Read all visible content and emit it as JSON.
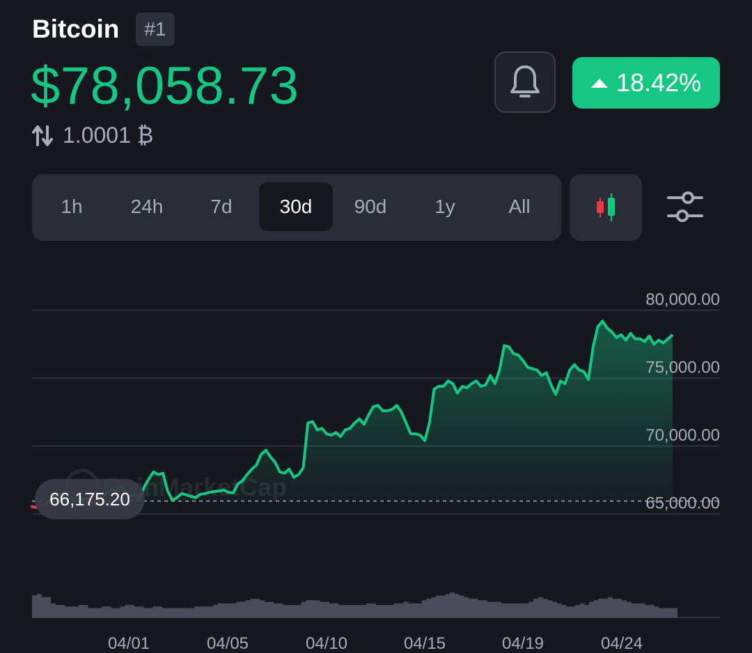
{
  "header": {
    "coin_name": "Bitcoin",
    "rank": "#1",
    "price": "$78,058.73",
    "btc_value": "1.0001 ₿",
    "change": "18.42%",
    "change_direction": "up",
    "icons": {
      "bell": "bell-icon",
      "swap": "swap-arrows-icon",
      "candles": "candlestick-icon",
      "settings": "sliders-settings-icon"
    }
  },
  "range_tabs": [
    "1h",
    "24h",
    "7d",
    "30d",
    "90d",
    "1y",
    "All"
  ],
  "active_range": "30d",
  "colors": {
    "background": "#17181f",
    "up": "#16c784",
    "down": "#ea3943",
    "panel": "#2a2c37",
    "muted": "#a9adbb"
  },
  "chart_data": {
    "type": "line",
    "ylim": [
      62500,
      82500
    ],
    "yticks": [
      80000,
      75000,
      70000,
      65000
    ],
    "ytick_labels": [
      "80,000.00",
      "75,000.00",
      "70,000.00",
      "65,000.00"
    ],
    "x_labels": [
      "04/01",
      "04/05",
      "04/10",
      "04/15",
      "04/19",
      "04/24"
    ],
    "baseline_label": "66,175.20",
    "baseline_value": 65950,
    "watermark": "CoinMarketCap",
    "series": [
      {
        "values": [
          65530,
          65480,
          65620,
          65700,
          66100,
          66300,
          66200,
          66050,
          66250,
          66000,
          65950,
          66150,
          66100,
          65800,
          65750,
          66300,
          66500,
          66800,
          66700,
          67000,
          66600,
          66300,
          66450,
          66100,
          67000,
          67600,
          68100,
          67900,
          68000,
          66700,
          66000,
          66200,
          66500,
          66400,
          66300,
          66200,
          66450,
          66500,
          66600,
          66650,
          66700,
          66750,
          66600,
          66550,
          67200,
          67450,
          67900,
          68300,
          68600,
          69400,
          69700,
          69200,
          68800,
          68100,
          68000,
          68300,
          67700,
          67900,
          68400,
          71700,
          71800,
          71200,
          71300,
          70900,
          70800,
          71000,
          70700,
          71200,
          71300,
          71700,
          72000,
          71600,
          72300,
          72900,
          73000,
          72600,
          72600,
          72700,
          73000,
          72500,
          71700,
          70900,
          70900,
          70800,
          70400,
          71700,
          74200,
          74400,
          74400,
          74800,
          74600,
          73900,
          74400,
          74300,
          74600,
          74800,
          74400,
          74500,
          75200,
          74600,
          75600,
          77400,
          77300,
          76800,
          76700,
          76300,
          75800,
          75700,
          75600,
          75200,
          75400,
          74500,
          73800,
          74800,
          74600,
          75600,
          76000,
          75600,
          75500,
          74900,
          77300,
          78800,
          79200,
          78700,
          78400,
          78000,
          78200,
          77800,
          78300,
          77900,
          77900,
          77700,
          78100,
          77500,
          77800,
          77600,
          77900,
          78200
        ]
      },
      {
        "name": "volume",
        "values": [
          14,
          15,
          13,
          13,
          9,
          8,
          8,
          7,
          7,
          7,
          8,
          8,
          6,
          6,
          6,
          7,
          7,
          6,
          6,
          7,
          8,
          8,
          7,
          7,
          6,
          6,
          7,
          7,
          6,
          6,
          6,
          6,
          6,
          6,
          6,
          7,
          7,
          7,
          7,
          8,
          9,
          9,
          9,
          9,
          10,
          10,
          11,
          12,
          12,
          11,
          10,
          10,
          9,
          9,
          8,
          8,
          8,
          8,
          10,
          11,
          11,
          11,
          10,
          10,
          9,
          9,
          8,
          8,
          8,
          8,
          8,
          8,
          9,
          9,
          8,
          8,
          8,
          8,
          9,
          9,
          10,
          9,
          9,
          9,
          11,
          12,
          13,
          14,
          14,
          15,
          16,
          15,
          14,
          13,
          12,
          12,
          11,
          11,
          10,
          10,
          10,
          9,
          9,
          9,
          9,
          9,
          9,
          10,
          12,
          13,
          12,
          11,
          10,
          9,
          8,
          7,
          7,
          8,
          9,
          8,
          10,
          11,
          12,
          12,
          13,
          12,
          12,
          11,
          10,
          9,
          9,
          9,
          8,
          8,
          7,
          6,
          6,
          6,
          6
        ]
      }
    ]
  }
}
